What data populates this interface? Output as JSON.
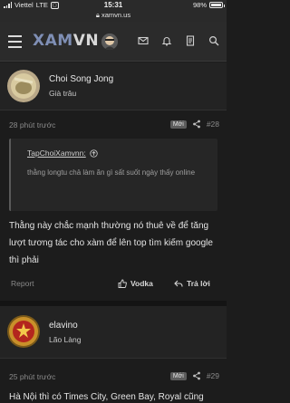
{
  "status_bar": {
    "carrier": "Viettel",
    "network": "LTE",
    "time": "15:31",
    "url": "xamvn.us",
    "battery": "98%"
  },
  "navbar": {
    "logo_main": "XAM",
    "logo_accent": "VN",
    "icons": [
      "menu-icon",
      "avatar",
      "mail-icon",
      "bell-icon",
      "document-icon",
      "search-icon"
    ]
  },
  "posts": [
    {
      "username": "Choi Song Jong",
      "role": "Già trâu"
    },
    {
      "time": "28 phút trước",
      "badge": "Mới",
      "number": "#28",
      "quote": {
        "author": "TapChoiXamvnn:",
        "text": "thằng longtu chả làm ăn gì sất suốt ngày thấy online"
      },
      "body": "Thằng này chắc mạnh thường nó thuê về để tăng lượt tương tác cho xàm để lên top tìm kiếm google thì phải",
      "report": "Report",
      "like_label": "Vodka",
      "reply_label": "Trả lời"
    },
    {
      "username": "elavino",
      "role": "Lão Làng",
      "time": "25 phút trước",
      "badge": "Mới",
      "number": "#29",
      "body": "Hà Nội thì có Times City, Green Bay, Royal cũng"
    }
  ],
  "colors": {
    "background": "#1c1c1c",
    "header": "#2b2b2b",
    "logo": "#7f8fb5"
  }
}
